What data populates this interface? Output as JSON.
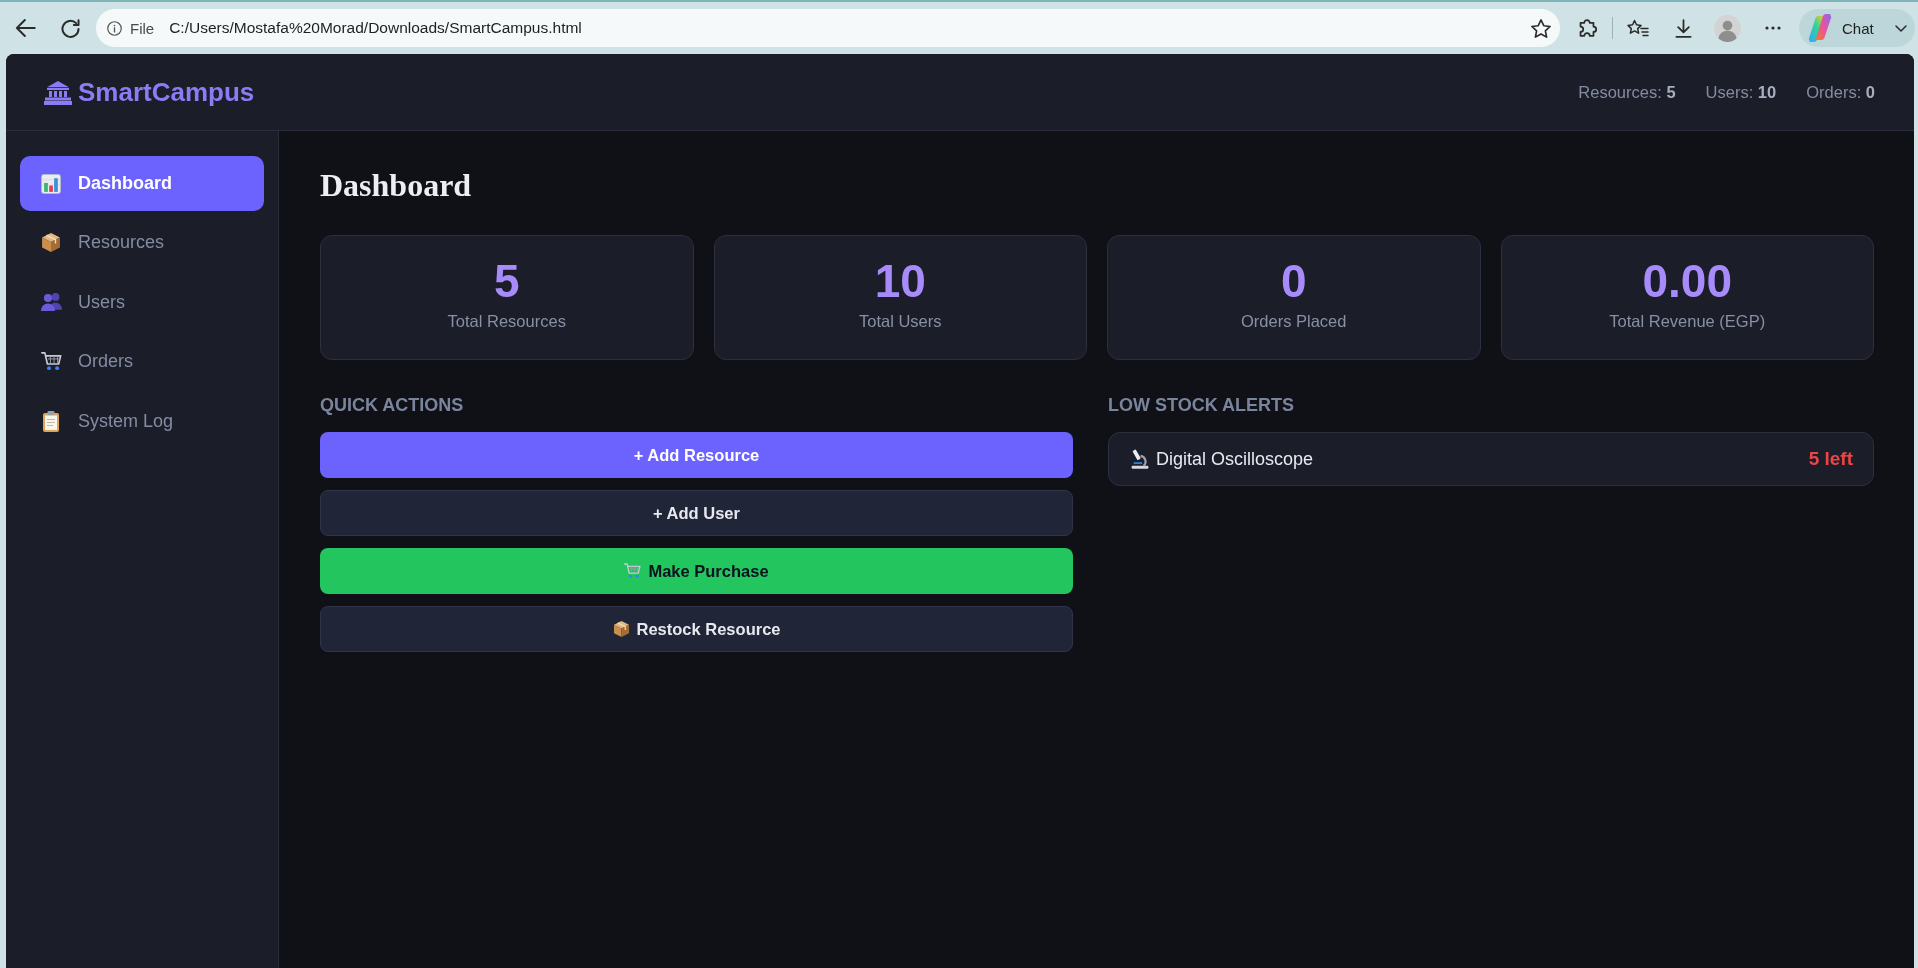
{
  "browser": {
    "address_bar": {
      "scheme": "File",
      "url": "C:/Users/Mostafa%20Morad/Downloads/SmartCampus.html"
    },
    "chat_button": {
      "label": "Chat"
    }
  },
  "header": {
    "logo": "SmartCampus",
    "stats": [
      "Resources: **5**",
      "Users: **10**",
      "Orders: **0**"
    ]
  },
  "sidebar": {
    "items": [
      {
        "label": "Dashboard",
        "selected": true
      },
      {
        "label": "Resources",
        "selected": false
      },
      {
        "label": "Users",
        "selected": false
      },
      {
        "label": "Orders",
        "selected": false
      },
      {
        "label": "System Log",
        "selected": false
      }
    ]
  },
  "main": {
    "title": "Dashboard",
    "stat_cards": [
      {
        "value": "5",
        "label": "Total Resources"
      },
      {
        "value": "10",
        "label": "Total Users"
      },
      {
        "value": "0",
        "label": "Orders Placed"
      },
      {
        "value": "0.00",
        "label": "Total Revenue (EGP)"
      }
    ],
    "quick_actions": {
      "heading": "QUICK ACTIONS",
      "buttons": [
        {
          "label": "+ Add Resource",
          "kind": "primary"
        },
        {
          "label": "+ Add User",
          "kind": "secondary"
        },
        {
          "label": "Make Purchase",
          "kind": "success"
        },
        {
          "label": "Restock Resource",
          "kind": "secondary"
        }
      ]
    },
    "low_stock_alerts": {
      "heading": "LOW STOCK ALERTS",
      "items": [
        {
          "name": "Digital Oscilloscope",
          "remaining": "5 left"
        }
      ]
    }
  }
}
